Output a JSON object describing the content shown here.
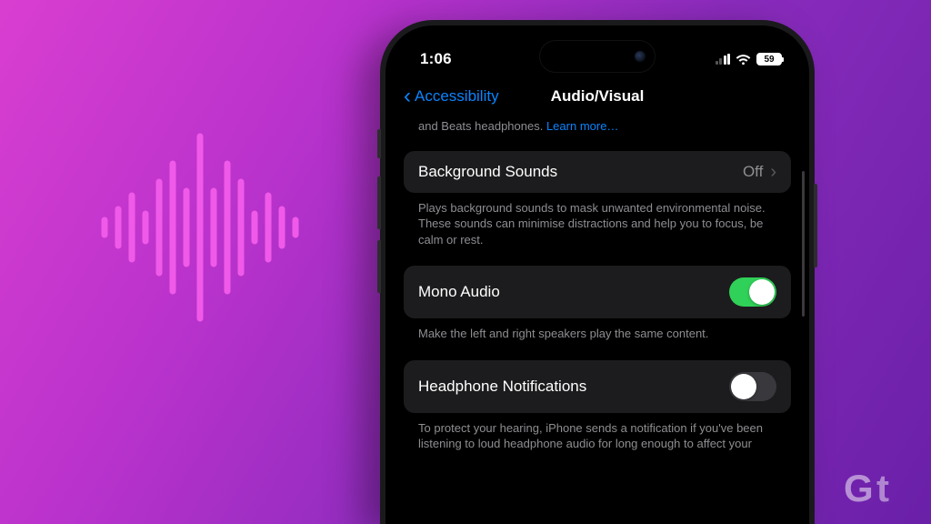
{
  "statusBar": {
    "time": "1:06",
    "batteryPercent": "59"
  },
  "nav": {
    "backLabel": "Accessibility",
    "title": "Audio/Visual"
  },
  "intro": {
    "textPrefix": "and Beats headphones. ",
    "linkLabel": "Learn more…"
  },
  "rows": {
    "backgroundSounds": {
      "label": "Background Sounds",
      "value": "Off",
      "footer": "Plays background sounds to mask unwanted environmental noise. These sounds can minimise distractions and help you to focus, be calm or rest."
    },
    "monoAudio": {
      "label": "Mono Audio",
      "footer": "Make the left and right speakers play the same content."
    },
    "headphoneNotifications": {
      "label": "Headphone Notifications",
      "footer": "To protect your hearing, iPhone sends a notification if you've been listening to loud headphone audio for long enough to affect your"
    }
  },
  "watermark": {
    "label": "Gt"
  }
}
